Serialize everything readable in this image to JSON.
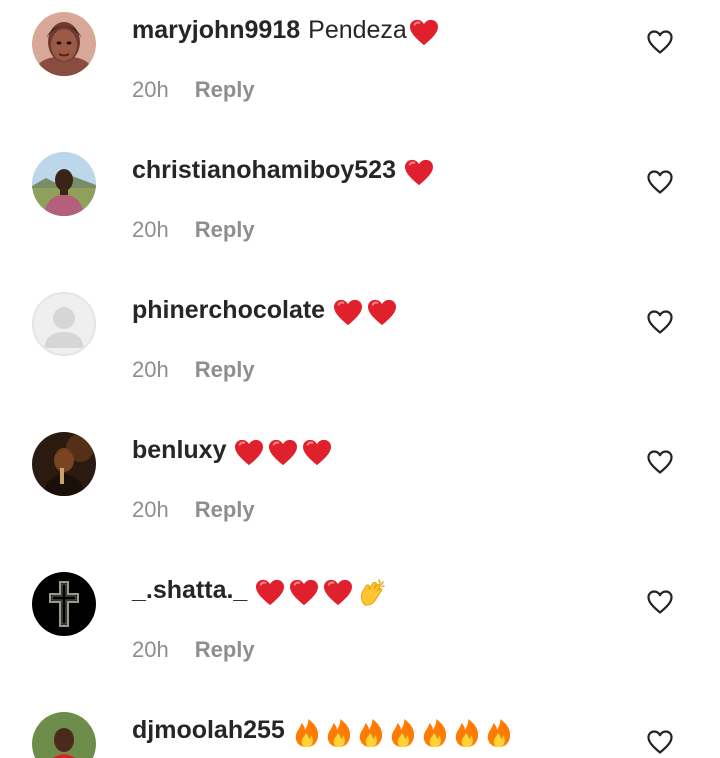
{
  "comments": [
    {
      "username": "maryjohn9918",
      "text": "Pendeza",
      "emojis": [
        "red-heart"
      ],
      "time": "20h",
      "reply_label": "Reply"
    },
    {
      "username": "christianohamiboy523",
      "text": "",
      "emojis": [
        "red-heart"
      ],
      "time": "20h",
      "reply_label": "Reply"
    },
    {
      "username": "phinerchocolate",
      "text": "",
      "emojis": [
        "red-heart",
        "red-heart"
      ],
      "time": "20h",
      "reply_label": "Reply"
    },
    {
      "username": "benluxy",
      "text": "",
      "emojis": [
        "red-heart",
        "red-heart",
        "red-heart"
      ],
      "time": "20h",
      "reply_label": "Reply"
    },
    {
      "username": "_.shatta._",
      "text": "",
      "emojis": [
        "red-heart",
        "red-heart",
        "red-heart",
        "clapping-hands"
      ],
      "time": "20h",
      "reply_label": "Reply"
    },
    {
      "username": "djmoolah255",
      "text": "",
      "emojis": [
        "fire",
        "fire",
        "fire",
        "fire",
        "fire",
        "fire",
        "fire"
      ],
      "time": "",
      "reply_label": ""
    }
  ],
  "colors": {
    "username": "#262626",
    "meta": "#8e8e8e",
    "heart_emoji": "#e0202c",
    "fire_emoji": "#ff7a00",
    "like_icon": "#262626"
  }
}
